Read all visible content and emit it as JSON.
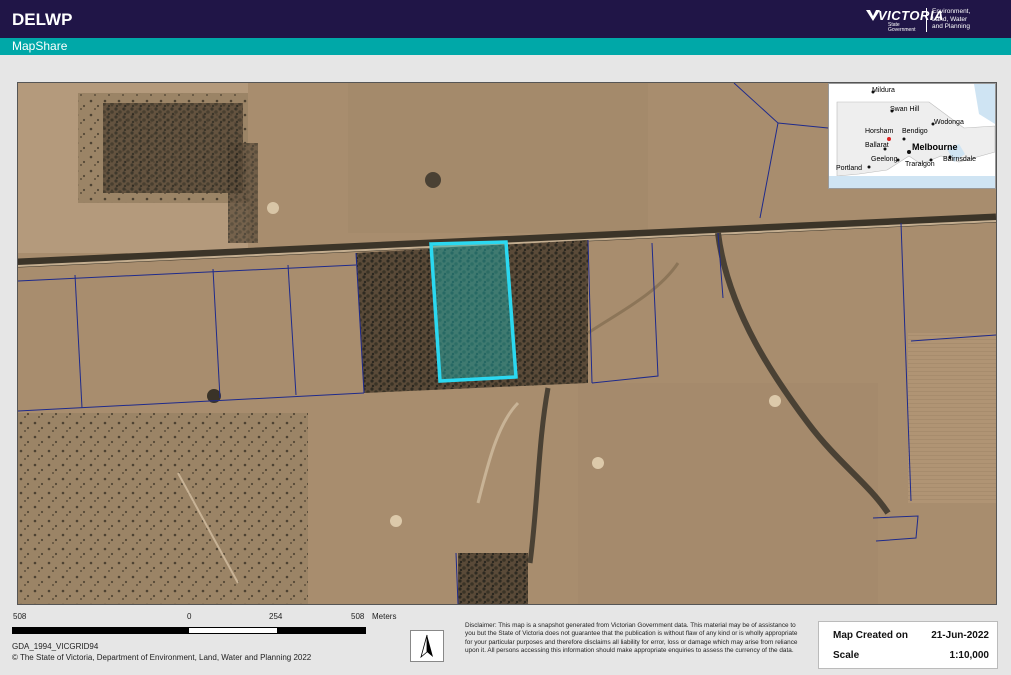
{
  "header": {
    "brand": "DELWP",
    "logo_word": "VICTORIA",
    "logo_sub": [
      "State",
      "Government"
    ],
    "department": [
      "Environment,",
      "Land, Water",
      "and Planning"
    ]
  },
  "subheader": {
    "title": "MapShare"
  },
  "inset_map": {
    "places": [
      "Mildura",
      "Swan Hill",
      "Wodonga",
      "Horsham",
      "Bendigo",
      "Ballarat",
      "Melbourne",
      "Geelong",
      "Traralgon",
      "Bairnsdale",
      "Portland"
    ]
  },
  "scale_bar": {
    "labels": [
      "508",
      "0",
      "254",
      "508"
    ],
    "unit": "Meters"
  },
  "projection": "GDA_1994_VICGRID94",
  "copyright": "© The State of Victoria, Department of Environment, Land, Water and Planning 2022",
  "disclaimer": "Disclaimer: This map is a snapshot generated from Victorian Government data. This material may be of assistance to you but the State of Victoria does not guarantee that the publication is without flaw of any kind or is wholly appropriate for your particular purposes and therefore disclaims all liability for error, loss or damage which may arise from reliance upon it. All persons accessing this information should make appropriate enquiries to assess the currency of the data.",
  "info": {
    "created_label": "Map Created on",
    "created_value": "21-Jun-2022",
    "scale_label": "Scale",
    "scale_value": "1:10,000"
  },
  "colors": {
    "header_bg": "#201547",
    "subheader_bg": "#00a8a8",
    "selection_outline": "#2bd8f0",
    "parcel_lines": "#1e2a8c"
  }
}
